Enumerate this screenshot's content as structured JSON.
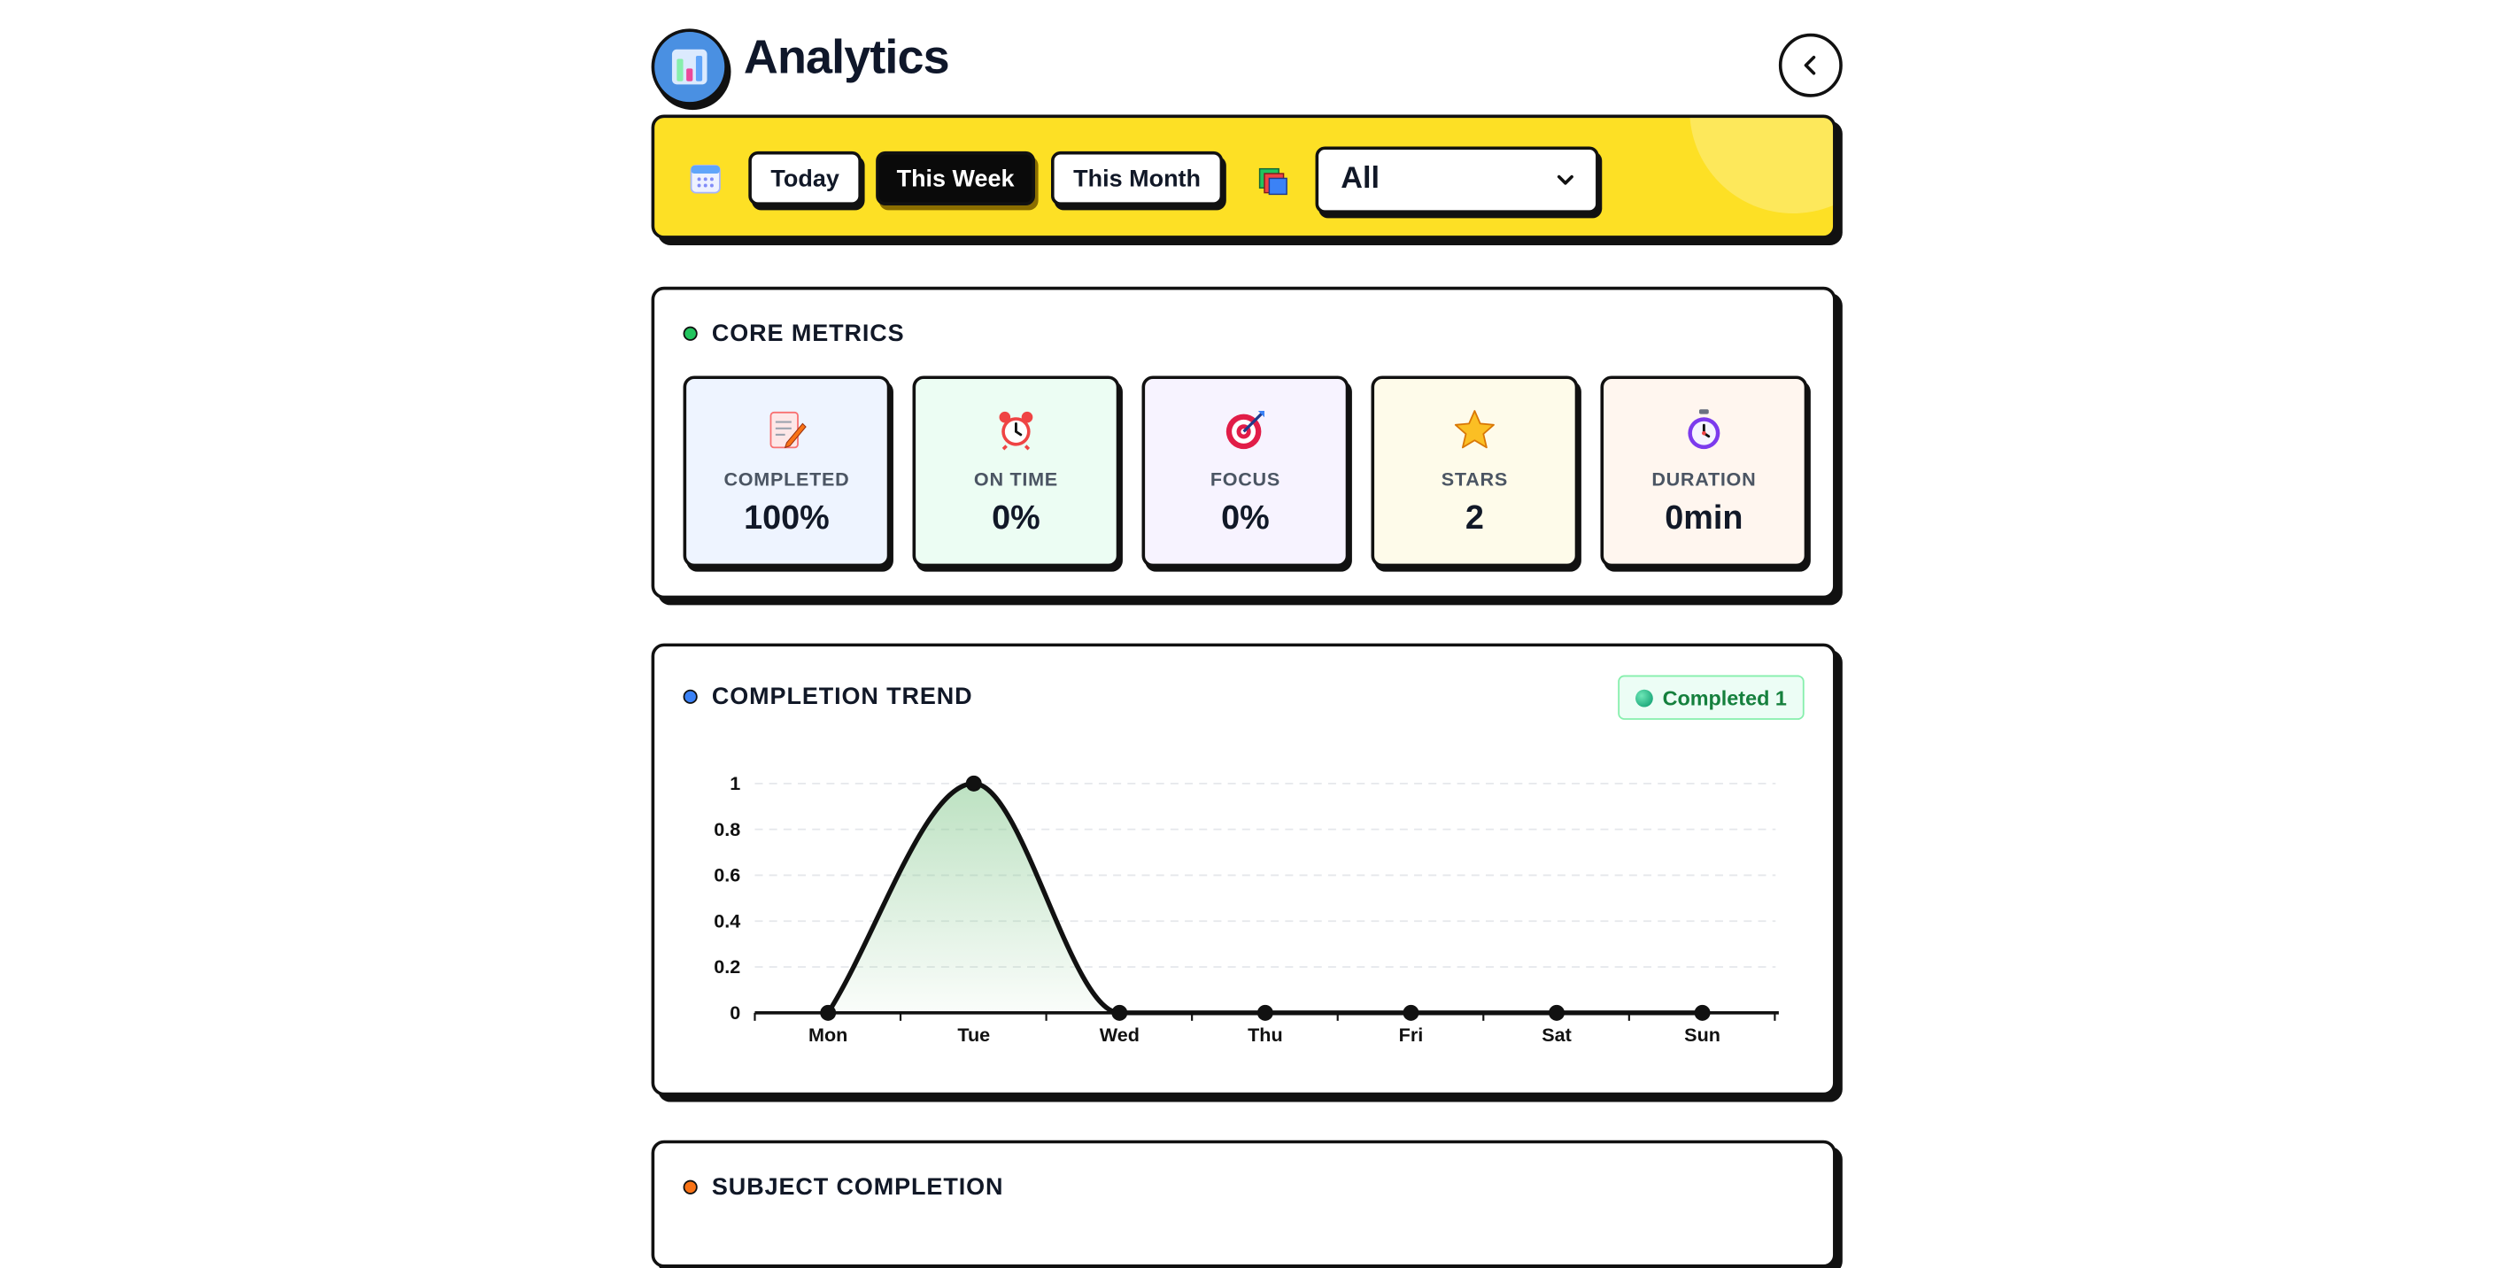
{
  "header": {
    "title": "Analytics",
    "back_icon": "chevron-left-icon"
  },
  "filters": {
    "calendar_icon": "calendar-icon",
    "range_options": [
      "Today",
      "This Week",
      "This Month"
    ],
    "selected_range": "This Week",
    "subject_icon": "books-icon",
    "subject_value": "All"
  },
  "core_metrics": {
    "title": "CORE METRICS",
    "dot_color": "#22c55e",
    "items": [
      {
        "icon": "memo-icon",
        "label": "COMPLETED",
        "value": "100%",
        "bg": "#eef4ff"
      },
      {
        "icon": "alarm-clock-icon",
        "label": "ON TIME",
        "value": "0%",
        "bg": "#ecfdf3"
      },
      {
        "icon": "target-icon",
        "label": "FOCUS",
        "value": "0%",
        "bg": "#f7f3ff"
      },
      {
        "icon": "star-icon",
        "label": "STARS",
        "value": "2",
        "bg": "#fefbea"
      },
      {
        "icon": "stopwatch-icon",
        "label": "DURATION",
        "value": "0min",
        "bg": "#fff6ef"
      }
    ]
  },
  "completion_trend": {
    "title": "COMPLETION TREND",
    "dot_color": "#3b82f6",
    "badge": "Completed 1",
    "line_color": "#111111",
    "fill_color": "#86c98f"
  },
  "chart_data": {
    "type": "area",
    "categories": [
      "Mon",
      "Tue",
      "Wed",
      "Thu",
      "Fri",
      "Sat",
      "Sun"
    ],
    "values": [
      0,
      1,
      0,
      0,
      0,
      0,
      0
    ],
    "ylim": [
      0,
      1
    ],
    "yticks": [
      "0",
      "0.2",
      "0.4",
      "0.6",
      "0.8",
      "1"
    ],
    "ytick_values": [
      0,
      0.2,
      0.4,
      0.6,
      0.8,
      1
    ],
    "grid": true,
    "legend": "none"
  },
  "subject_completion": {
    "title": "SUBJECT COMPLETION",
    "dot_color": "#f97316"
  }
}
